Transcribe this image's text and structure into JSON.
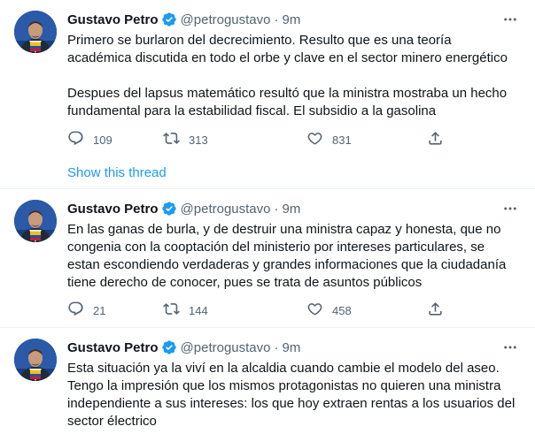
{
  "tweets": [
    {
      "author_name": "Gustavo Petro",
      "handle": "@petrogustavo",
      "separator": "·",
      "time": "9m",
      "paragraphs": [
        "Primero se burlaron del decrecimiento. Resulto que es una teoría académica discutida en todo el orbe y clave en el sector minero energético",
        "Despues del lapsus matemático resultó que la ministra mostraba un hecho fundamental para la estabilidad fiscal. El subsidio a la gasolina"
      ],
      "replies": "109",
      "retweets": "313",
      "likes": "831",
      "show_thread": "Show this thread"
    },
    {
      "author_name": "Gustavo Petro",
      "handle": "@petrogustavo",
      "separator": "·",
      "time": "9m",
      "paragraphs": [
        "En las ganas de burla, y de destruir una ministra capaz y honesta, que no congenia con la cooptación del ministerio por  intereses particulares, se estan escondiendo verdaderas y grandes informaciones que la ciudadanía tiene derecho de conocer, pues se trata de asuntos públicos"
      ],
      "replies": "21",
      "retweets": "144",
      "likes": "458"
    },
    {
      "author_name": "Gustavo Petro",
      "handle": "@petrogustavo",
      "separator": "·",
      "time": "9m",
      "paragraphs": [
        "Esta situación ya la viví en la alcaldia cuando cambie el modelo del aseo. Tengo la impresión que los mismos protagonistas no quieren una ministra independiente a sus intereses: los que hoy extraen rentas a los usuarios del sector électrico"
      ]
    }
  ],
  "colors": {
    "text": "#0f1419",
    "secondary": "#536471",
    "link": "#1d9bf0",
    "verified": "#1d9bf0",
    "divider": "#eff3f4"
  },
  "icons": [
    "more-icon",
    "verified-badge-icon",
    "reply-icon",
    "retweet-icon",
    "like-icon",
    "share-icon"
  ]
}
